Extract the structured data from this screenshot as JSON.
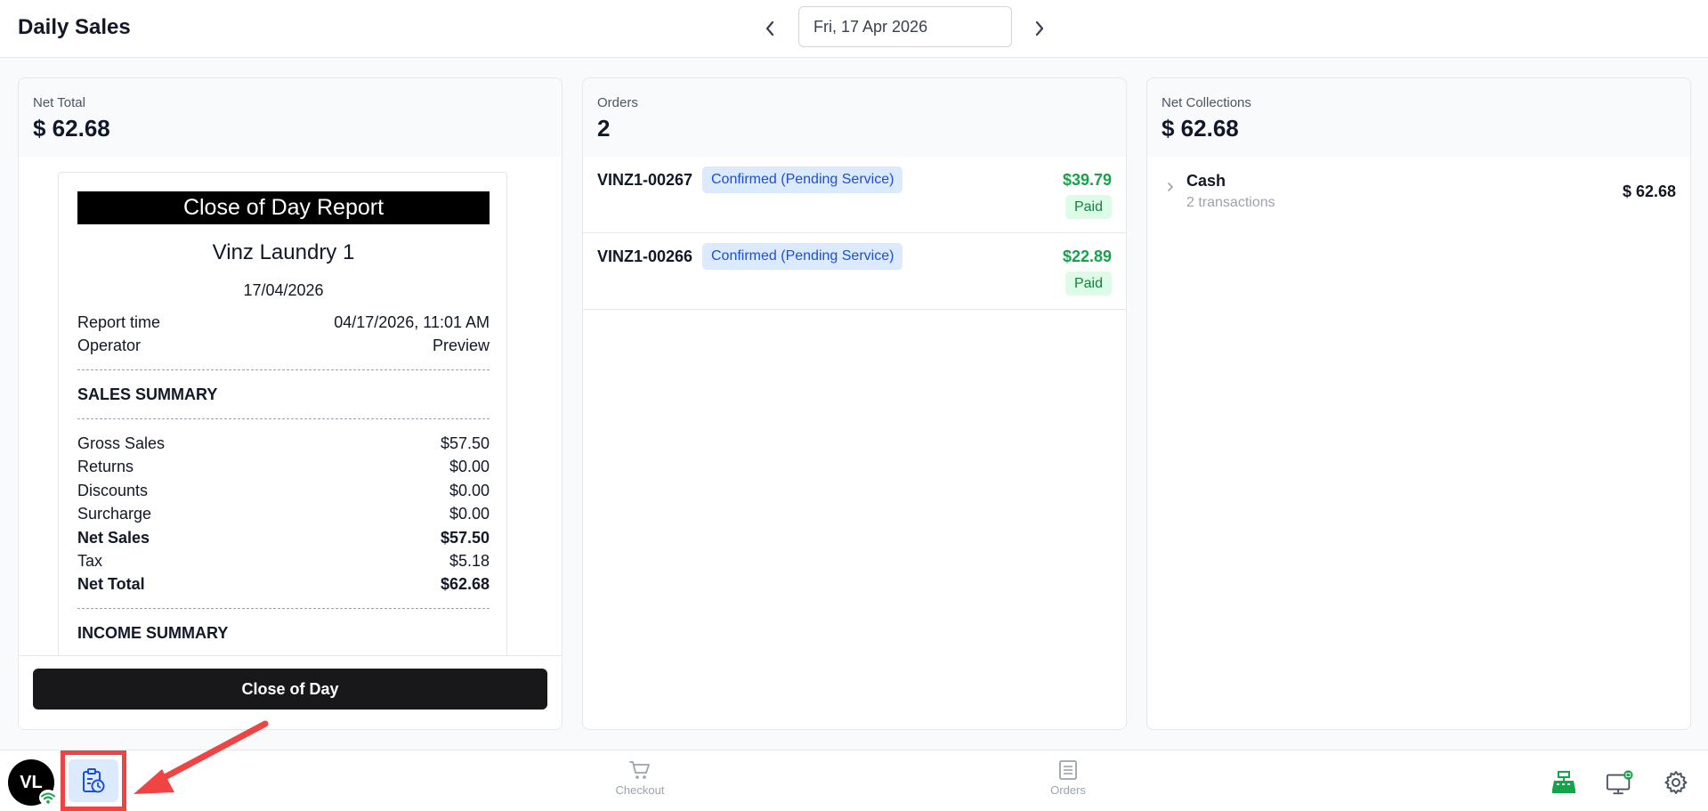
{
  "header": {
    "title": "Daily Sales",
    "date_value": "Fri, 17 Apr 2026"
  },
  "net_total_panel": {
    "label": "Net Total",
    "value": "$ 62.68",
    "close_button": "Close of Day"
  },
  "receipt": {
    "title": "Close of Day Report",
    "shop": "Vinz Laundry 1",
    "date": "17/04/2026",
    "meta": [
      {
        "label": "Report time",
        "value": "04/17/2026, 11:01 AM"
      },
      {
        "label": "Operator",
        "value": "Preview"
      }
    ],
    "sales_summary_title": "SALES SUMMARY",
    "sales_rows": [
      {
        "label": "Gross Sales",
        "value": "$57.50"
      },
      {
        "label": "Returns",
        "value": "$0.00"
      },
      {
        "label": "Discounts",
        "value": "$0.00"
      },
      {
        "label": "Surcharge",
        "value": "$0.00"
      },
      {
        "label": "Net Sales",
        "value": "$57.50"
      },
      {
        "label": "Tax",
        "value": "$5.18"
      },
      {
        "label": "Net Total",
        "value": "$62.68"
      }
    ],
    "income_summary_title": "INCOME SUMMARY"
  },
  "orders_panel": {
    "label": "Orders",
    "value": "2",
    "orders": [
      {
        "id": "VINZ1-00267",
        "status": "Confirmed (Pending Service)",
        "amount": "$39.79",
        "payment": "Paid"
      },
      {
        "id": "VINZ1-00266",
        "status": "Confirmed (Pending Service)",
        "amount": "$22.89",
        "payment": "Paid"
      }
    ]
  },
  "collections_panel": {
    "label": "Net Collections",
    "value": "$ 62.68",
    "methods": [
      {
        "name": "Cash",
        "sub": "2 transactions",
        "amount": "$ 62.68"
      }
    ]
  },
  "bottom_bar": {
    "avatar_initials": "VL",
    "checkout_label": "Checkout",
    "orders_label": "Orders"
  },
  "colors": {
    "accent_blue": "#1d4ed8",
    "paid_green": "#16a34a",
    "highlight_red": "#ef4444"
  }
}
